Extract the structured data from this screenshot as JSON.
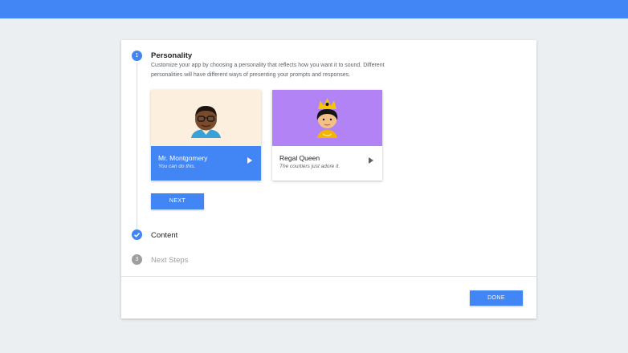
{
  "colors": {
    "accent": "#4285f4",
    "card1_art_bg": "#fcefde",
    "card2_art_bg": "#b183f4",
    "inactive_step": "#9e9e9e"
  },
  "steps": [
    {
      "number": "1",
      "title": "Personality",
      "state": "active",
      "description": "Customize your app by choosing a personality that reflects how you want it to sound. Different personalities will have different ways of presenting your prompts and responses."
    },
    {
      "number": "2",
      "title": "Content",
      "state": "completed",
      "icon": "check-icon"
    },
    {
      "number": "3",
      "title": "Next Steps",
      "state": "inactive"
    }
  ],
  "personalities": [
    {
      "name": "Mr. Montgomery",
      "quote": "You can do this.",
      "selected": true,
      "icon": "play-icon"
    },
    {
      "name": "Regal Queen",
      "quote": "The courtiers just adore it.",
      "selected": false,
      "icon": "play-icon"
    }
  ],
  "buttons": {
    "next": "NEXT",
    "done": "DONE"
  }
}
